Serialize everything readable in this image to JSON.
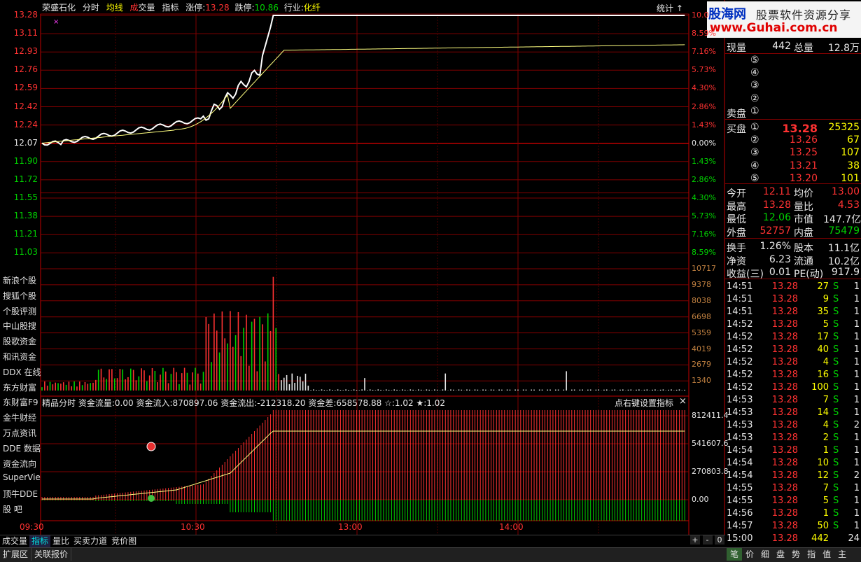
{
  "header": {
    "stock_name": "荣盛石化",
    "tab_fenshi": "分时",
    "tab_junxian": "均线",
    "tab_cheng": "成",
    "tab_jiaoliang": "交量",
    "tab_zhibiao": "指标",
    "zhangting_label": "涨停:",
    "zhangting_value": "13.28",
    "dieting_label": "跌停:",
    "dieting_value": "10.86",
    "hangye_label": "行业:",
    "hangye_value": "化纤",
    "tongji": "统计",
    "tongji_arrow": "↑"
  },
  "logo": {
    "brand": "股海网",
    "slogan": "股票软件资源分享",
    "url": "www.Guhai.com.cn"
  },
  "price_axis": {
    "left": [
      "13.28",
      "13.11",
      "12.93",
      "12.76",
      "12.59",
      "12.42",
      "12.24",
      "12.07",
      "11.90",
      "11.72",
      "11.55",
      "11.38",
      "11.21",
      "11.03"
    ],
    "right": [
      "10.0",
      "8.59%",
      "7.16%",
      "5.73%",
      "4.30%",
      "2.86%",
      "1.43%",
      "0.00%",
      "1.43%",
      "2.86%",
      "4.30%",
      "5.73%",
      "7.16%",
      "8.59%"
    ]
  },
  "volume_axis": [
    "10717",
    "9378",
    "8038",
    "6698",
    "5359",
    "4019",
    "2679",
    "1340"
  ],
  "indicator_axis": [
    "812411.4",
    "541607.6",
    "270803.8",
    "0.00"
  ],
  "indicator_header": {
    "name": "精品分时",
    "flow": "资金流量:0.00",
    "inflow": "资金流入:870897.06",
    "outflow": "资金流出:-212318.20",
    "diff": "资金差:658578.88",
    "star1": "☆:1.02",
    "star2": "★:1.02",
    "right_text": "点右键设置指标",
    "close": "×"
  },
  "time_axis": [
    "09:30",
    "10:30",
    "13:00",
    "14:00"
  ],
  "side_links": [
    "新浪个股",
    "搜狐个股",
    "个股评测",
    "中山股搜",
    "股歌资金",
    "和讯资金",
    "DDX 在线",
    "东方财富",
    "东财富F9",
    "金牛财经",
    "万点资讯",
    "DDE 数据",
    "资金流向",
    "SuperVie",
    "顶牛DDE",
    "股   吧"
  ],
  "quote": {
    "xianliang_label": "现量",
    "xianliang": "442",
    "zongliang_label": "总量",
    "zongliang": "12.8万",
    "sell_label": "卖盘",
    "sell_levels": [
      "⑤",
      "④",
      "③",
      "②",
      "①"
    ],
    "buy_label": "买盘",
    "buy_levels": [
      {
        "idx": "①",
        "price": "13.28",
        "vol": "25325"
      },
      {
        "idx": "②",
        "price": "13.26",
        "vol": "67"
      },
      {
        "idx": "③",
        "price": "13.25",
        "vol": "107"
      },
      {
        "idx": "④",
        "price": "13.21",
        "vol": "38"
      },
      {
        "idx": "⑤",
        "price": "13.20",
        "vol": "101"
      }
    ],
    "stats": [
      {
        "l1": "今开",
        "v1": "12.11",
        "c1": "red",
        "l2": "均价",
        "v2": "13.00",
        "c2": "red"
      },
      {
        "l1": "最高",
        "v1": "13.28",
        "c1": "red",
        "l2": "量比",
        "v2": "4.53",
        "c2": "red"
      },
      {
        "l1": "最低",
        "v1": "12.06",
        "c1": "green",
        "l2": "市值",
        "v2": "147.7亿",
        "c2": "white"
      },
      {
        "l1": "外盘",
        "v1": "52757",
        "c1": "red",
        "l2": "内盘",
        "v2": "75479",
        "c2": "green"
      }
    ],
    "stats2": [
      {
        "l1": "换手",
        "v1": "1.26%",
        "l2": "股本",
        "v2": "11.1亿"
      },
      {
        "l1": "净资",
        "v1": "6.23",
        "l2": "流通",
        "v2": "10.2亿"
      },
      {
        "l1": "收益(三)",
        "v1": "0.01",
        "l2": "PE(动)",
        "v2": "917.9"
      }
    ]
  },
  "ticks": [
    {
      "t": "14:51",
      "p": "13.28",
      "v": "27",
      "s": "S",
      "n": "1"
    },
    {
      "t": "14:51",
      "p": "13.28",
      "v": "9",
      "s": "S",
      "n": "1"
    },
    {
      "t": "14:51",
      "p": "13.28",
      "v": "35",
      "s": "S",
      "n": "1"
    },
    {
      "t": "14:52",
      "p": "13.28",
      "v": "5",
      "s": "S",
      "n": "1"
    },
    {
      "t": "14:52",
      "p": "13.28",
      "v": "17",
      "s": "S",
      "n": "1"
    },
    {
      "t": "14:52",
      "p": "13.28",
      "v": "40",
      "s": "S",
      "n": "1"
    },
    {
      "t": "14:52",
      "p": "13.28",
      "v": "4",
      "s": "S",
      "n": "1"
    },
    {
      "t": "14:52",
      "p": "13.28",
      "v": "16",
      "s": "S",
      "n": "1"
    },
    {
      "t": "14:52",
      "p": "13.28",
      "v": "100",
      "s": "S",
      "n": "1"
    },
    {
      "t": "14:53",
      "p": "13.28",
      "v": "7",
      "s": "S",
      "n": "1"
    },
    {
      "t": "14:53",
      "p": "13.28",
      "v": "14",
      "s": "S",
      "n": "1"
    },
    {
      "t": "14:53",
      "p": "13.28",
      "v": "4",
      "s": "S",
      "n": "2"
    },
    {
      "t": "14:53",
      "p": "13.28",
      "v": "2",
      "s": "S",
      "n": "1"
    },
    {
      "t": "14:54",
      "p": "13.28",
      "v": "1",
      "s": "S",
      "n": "1"
    },
    {
      "t": "14:54",
      "p": "13.28",
      "v": "10",
      "s": "S",
      "n": "1"
    },
    {
      "t": "14:54",
      "p": "13.28",
      "v": "12",
      "s": "S",
      "n": "2"
    },
    {
      "t": "14:55",
      "p": "13.28",
      "v": "7",
      "s": "S",
      "n": "1"
    },
    {
      "t": "14:55",
      "p": "13.28",
      "v": "5",
      "s": "S",
      "n": "1"
    },
    {
      "t": "14:56",
      "p": "13.28",
      "v": "1",
      "s": "S",
      "n": "1"
    },
    {
      "t": "14:57",
      "p": "13.28",
      "v": "50",
      "s": "S",
      "n": "1"
    },
    {
      "t": "15:00",
      "p": "13.28",
      "v": "442",
      "s": "",
      "n": "24"
    }
  ],
  "bottom_tabs": [
    "成交量",
    "指标",
    "量比",
    "买卖力道",
    "竞价图"
  ],
  "zoom": {
    "plus": "+",
    "minus": "-",
    "zero": "0"
  },
  "status_left": [
    "扩展区",
    "关联报价"
  ],
  "status_right": [
    "笔",
    "价",
    "细",
    "盘",
    "势",
    "指",
    "值",
    "主"
  ],
  "colors": {
    "up": "#ff3232",
    "down": "#00d200",
    "vol": "#e8e8e8",
    "grid": "#800000",
    "avg": "#ffff80"
  }
}
